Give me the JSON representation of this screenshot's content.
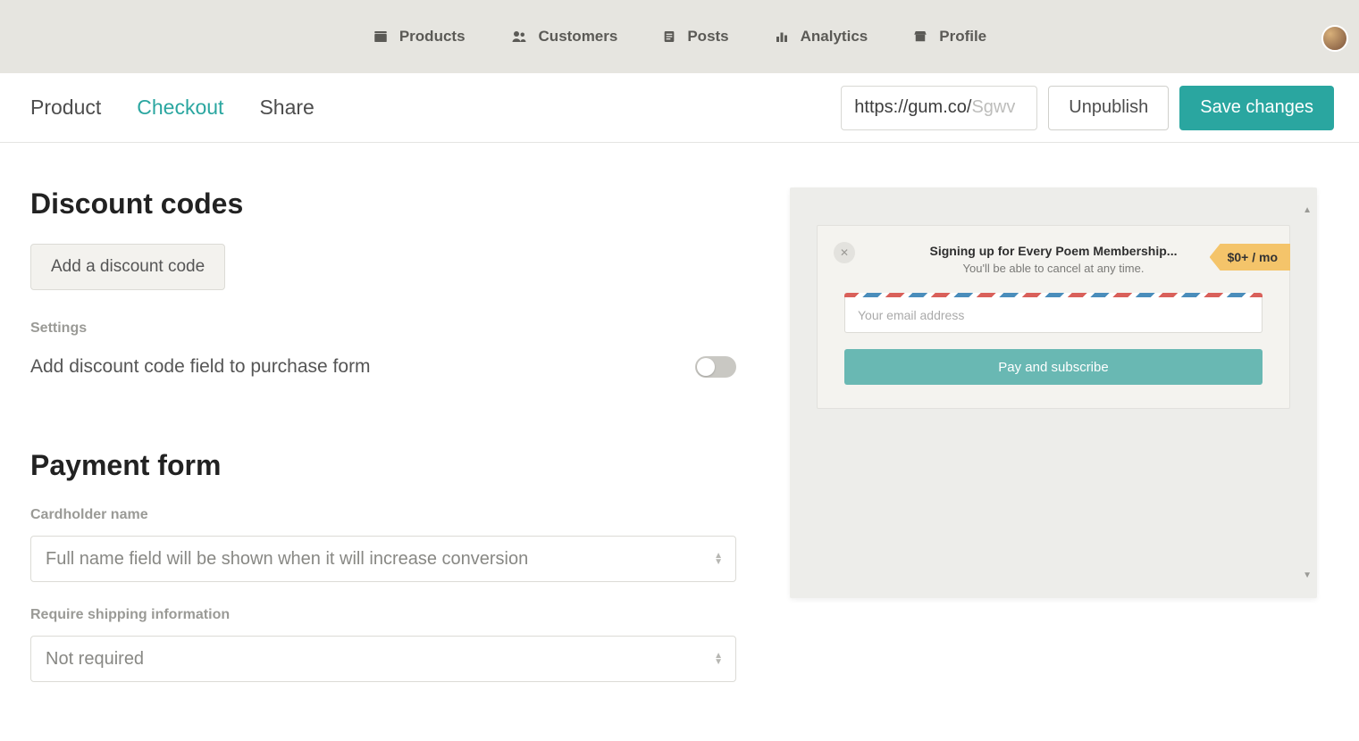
{
  "topnav": {
    "items": [
      {
        "label": "Products",
        "icon": "box"
      },
      {
        "label": "Customers",
        "icon": "people"
      },
      {
        "label": "Posts",
        "icon": "doc"
      },
      {
        "label": "Analytics",
        "icon": "bars"
      },
      {
        "label": "Profile",
        "icon": "store"
      }
    ]
  },
  "subheader": {
    "tabs": [
      {
        "label": "Product"
      },
      {
        "label": "Checkout"
      },
      {
        "label": "Share"
      }
    ],
    "active_tab_index": 1,
    "url_prefix": "https://gum.co/",
    "url_slug": "Sgwv",
    "unpublish_label": "Unpublish",
    "save_label": "Save changes"
  },
  "sections": {
    "discount": {
      "title": "Discount codes",
      "add_button": "Add a discount code",
      "settings_label": "Settings",
      "toggle_label": "Add discount code field to purchase form",
      "toggle_on": false
    },
    "payment": {
      "title": "Payment form",
      "cardholder_label": "Cardholder name",
      "cardholder_value": "Full name field will be shown when it will increase conversion",
      "shipping_label": "Require shipping information",
      "shipping_value": "Not required"
    }
  },
  "preview": {
    "signup_title": "Signing up for Every Poem Membership...",
    "signup_sub": "You'll be able to cancel at any time.",
    "price_tag": "$0+ / mo",
    "email_placeholder": "Your email address",
    "pay_button": "Pay and subscribe"
  }
}
